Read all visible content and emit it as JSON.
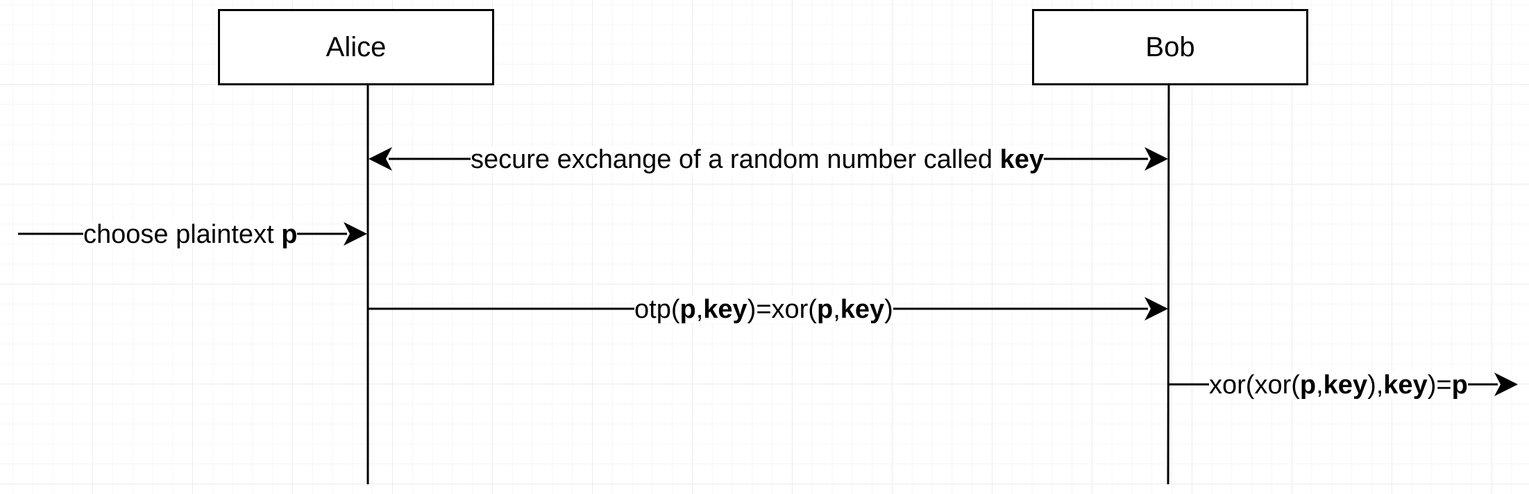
{
  "actors": {
    "alice": "Alice",
    "bob": "Bob"
  },
  "messages": {
    "key_exchange": {
      "text": "secure exchange of a random number called ",
      "bold": "key"
    },
    "choose_plaintext": {
      "text": "choose plaintext ",
      "bold": "p"
    },
    "encrypt": {
      "open": "otp(",
      "p1": "p",
      "comma1": ",",
      "key1": "key",
      "mid": ")=xor(",
      "p2": "p",
      "comma2": ",",
      "key2": "key",
      "close": ")"
    },
    "decrypt": {
      "open": "xor(xor(",
      "p1": "p",
      "comma1": ",",
      "key1": "key",
      "mid": "),",
      "key2": "key",
      "eq": ")=",
      "p2": "p"
    }
  },
  "colors": {
    "line": "#000000",
    "grid": "#ededed",
    "background": "#ffffff"
  }
}
